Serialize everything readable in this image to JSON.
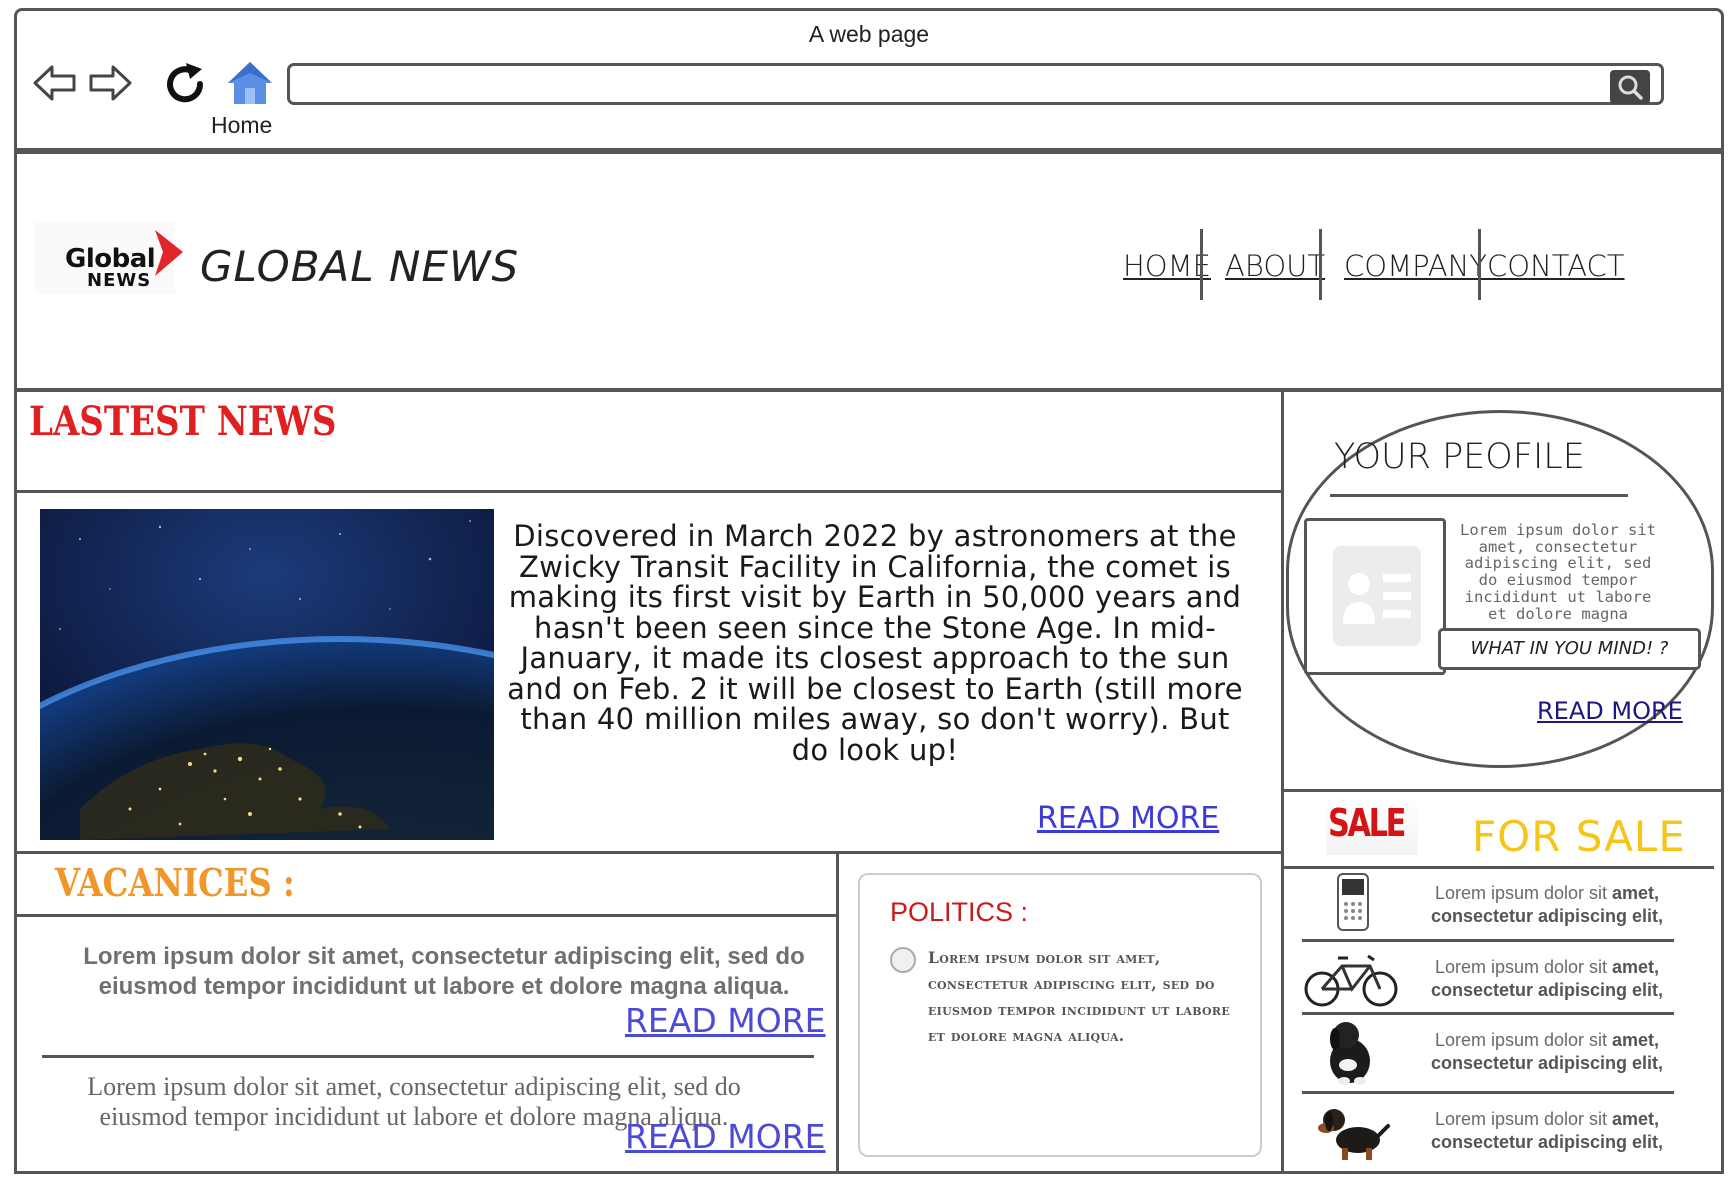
{
  "browser": {
    "title": "A web page",
    "home_label": "Home",
    "url": ""
  },
  "header": {
    "logo_line1": "Global",
    "logo_line2": "NEWS",
    "site_title": "GLOBAL NEWS",
    "nav": [
      "HOME",
      "ABOUT",
      "COMPANY",
      "CONTACT"
    ]
  },
  "latest": {
    "title": "LASTEST NEWS",
    "story": "Discovered in March 2022 by astronomers at the Zwicky Transit Facility in California, the comet is making its first visit by Earth in 50,000 years and hasn't been seen since the Stone Age. In mid-January, it made its closest approach to the sun and on Feb. 2 it will be closest to Earth (still more than 40 million miles away, so don't worry). But do look up!",
    "read_more": "READ MORE"
  },
  "vacancies": {
    "title": "VACANICES :",
    "item1": "Lorem ipsum dolor sit amet, consectetur adipiscing elit, sed do eiusmod tempor incididunt ut labore et dolore magna aliqua.",
    "item1_more": "READ MORE",
    "item2": "Lorem ipsum dolor sit amet, consectetur adipiscing elit, sed do eiusmod tempor incididunt ut labore et dolore magna aliqua.",
    "item2_more": "READ MORE"
  },
  "politics": {
    "title": "POLITICS :",
    "text": "Lorem ipsum dolor sit amet, consectetur adipiscing elit, sed do eiusmod tempor incididunt ut labore et dolore magna aliqua."
  },
  "profile": {
    "title": "YOUR PEOFILE",
    "lorem": "Lorem ipsum dolor sit amet, consectetur adipiscing elit, sed do eiusmod tempor incididunt ut labore et dolore magna aliqua.",
    "mind_placeholder": "WHAT IN YOU MIND! ?",
    "read_more": "READ MORE"
  },
  "sale": {
    "logo_text": "SALE",
    "title": "FOR SALE",
    "items": [
      {
        "icon": "phone-icon",
        "text_a": "Lorem ipsum dolor sit ",
        "text_b": "amet,",
        "text_c": "consectetur adipiscing elit,"
      },
      {
        "icon": "bicycle-icon",
        "text_a": "Lorem ipsum dolor sit ",
        "text_b": "amet,",
        "text_c": "consectetur adipiscing elit,"
      },
      {
        "icon": "puppy-icon",
        "text_a": "Lorem ipsum dolor sit ",
        "text_b": "amet,",
        "text_c": "consectetur adipiscing elit,"
      },
      {
        "icon": "dachshund-icon",
        "text_a": "Lorem ipsum dolor sit ",
        "text_b": "amet,",
        "text_c": "consectetur adipiscing elit,"
      }
    ]
  },
  "colors": {
    "red_heading": "#e02020",
    "orange_heading": "#f0962a",
    "link_blue": "#3b3bdc",
    "sale_yellow": "#f5c518",
    "politics_red": "#cc1a1a"
  }
}
